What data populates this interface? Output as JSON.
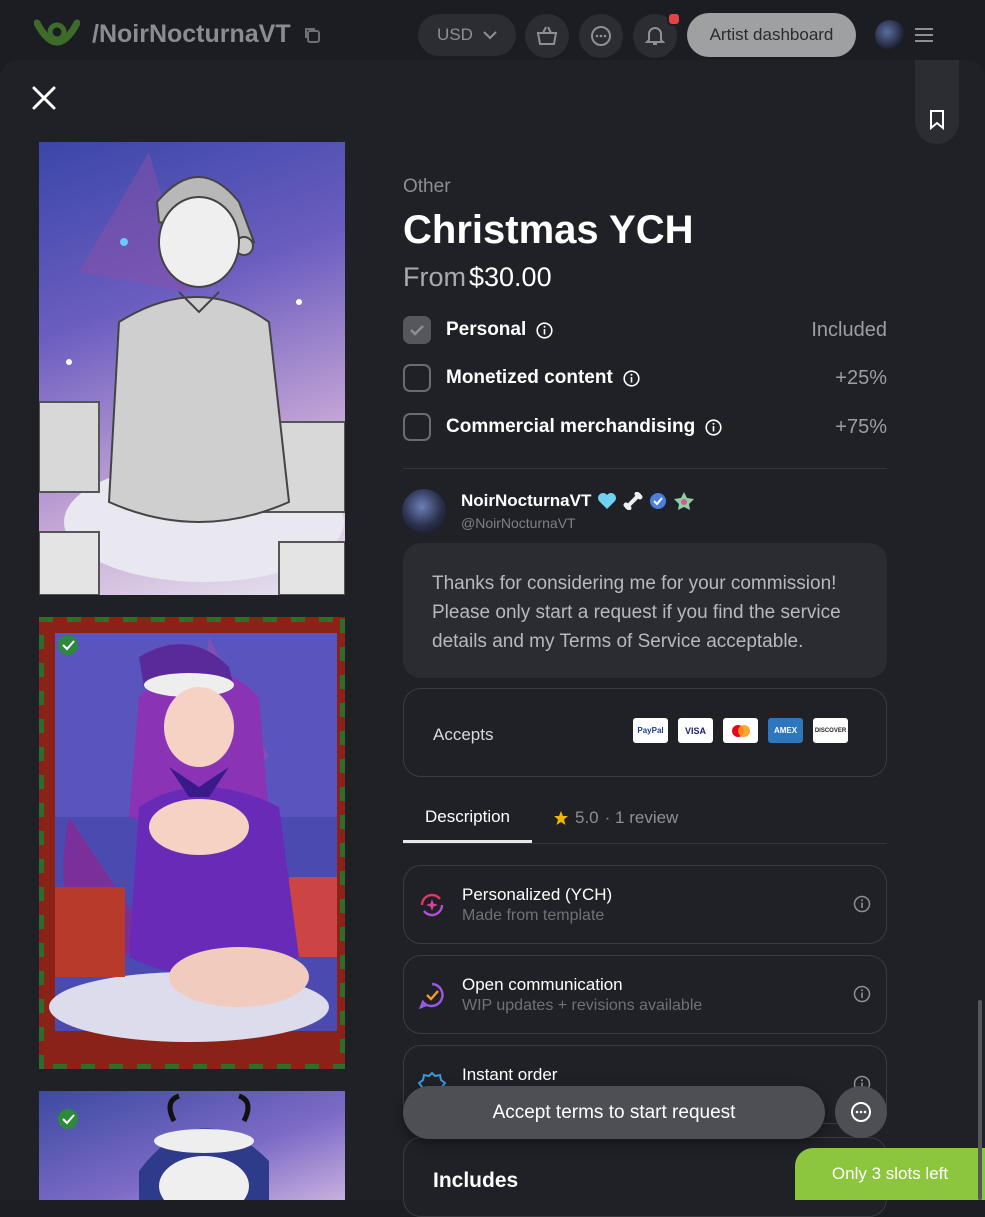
{
  "header": {
    "brand": "/NoirNocturnaVT",
    "currency": "USD",
    "dashboard_label": "Artist dashboard"
  },
  "service": {
    "category": "Other",
    "title": "Christmas YCH",
    "price_prefix": "From",
    "price": "$30.00"
  },
  "license_options": [
    {
      "label": "Personal",
      "price": "Included",
      "checked": true
    },
    {
      "label": "Monetized content",
      "price": "+25%",
      "checked": false
    },
    {
      "label": "Commercial merchandising",
      "price": "+75%",
      "checked": false
    }
  ],
  "artist": {
    "name": "NoirNocturnaVT",
    "handle": "@NoirNocturnaVT",
    "message": "Thanks for considering me for your commission! Please only start a request if you find the service details and my Terms of Service acceptable."
  },
  "payments": {
    "label": "Accepts",
    "methods": [
      "PayPal",
      "VISA",
      "Mastercard",
      "AMEX",
      "DISCOVER"
    ]
  },
  "tabs": {
    "description": "Description",
    "rating": "5.0",
    "reviews": "· 1 review"
  },
  "features": [
    {
      "title": "Personalized (YCH)",
      "subtitle": "Made from template",
      "icon": "sparkle-refresh-icon"
    },
    {
      "title": "Open communication",
      "subtitle": "WIP updates + revisions available",
      "icon": "chat-check-icon"
    },
    {
      "title": "Instant order",
      "subtitle": "",
      "icon": "badge-icon"
    }
  ],
  "cta_label": "Accept terms to start request",
  "includes_label": "Includes",
  "slots_label": "Only 3 slots left",
  "colors": {
    "accent_green": "#8cc63f",
    "modal_bg": "#1f2127"
  }
}
